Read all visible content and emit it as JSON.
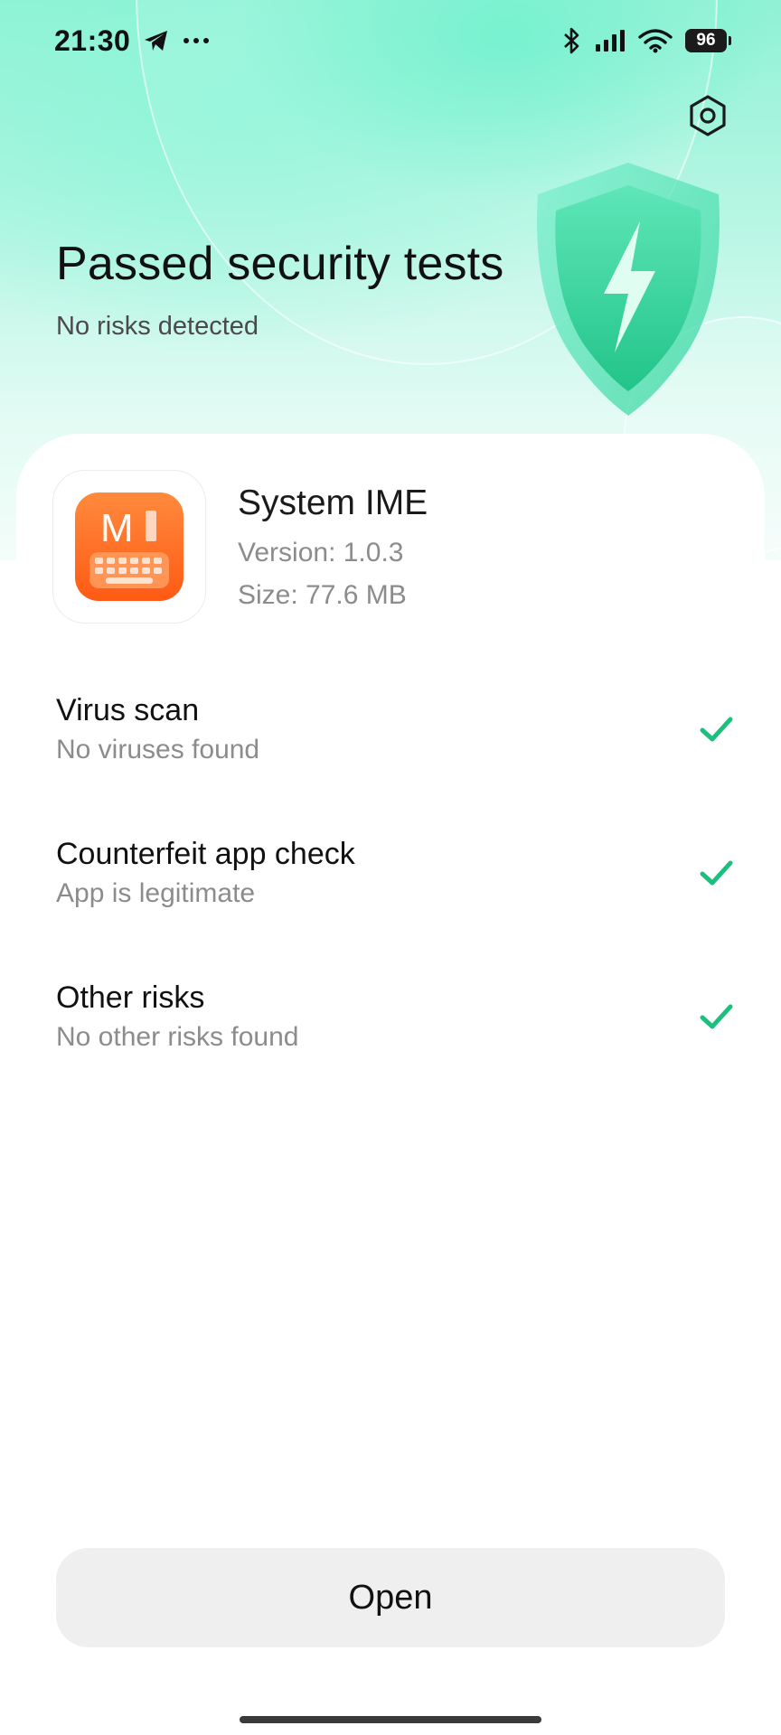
{
  "status_bar": {
    "time": "21:30",
    "battery": "96",
    "icons": [
      "telegram-icon",
      "more-dots-icon",
      "bluetooth-icon",
      "signal-icon",
      "wifi-icon",
      "battery-icon"
    ]
  },
  "header": {
    "title": "Passed security tests",
    "subtitle": "No risks detected",
    "settings_icon": "settings-icon",
    "accent_color": "#1dbf7f"
  },
  "app": {
    "name": "System IME",
    "version": "Version: 1.0.3",
    "size": "Size: 77.6 MB",
    "icon_letter": "M",
    "icon_color": "#ff6a1a"
  },
  "checks": [
    {
      "title": "Virus scan",
      "subtitle": "No viruses found",
      "status_icon": "checkmark-icon"
    },
    {
      "title": "Counterfeit app check",
      "subtitle": "App is legitimate",
      "status_icon": "checkmark-icon"
    },
    {
      "title": "Other risks",
      "subtitle": "No other risks found",
      "status_icon": "checkmark-icon"
    }
  ],
  "actions": {
    "open_label": "Open"
  }
}
